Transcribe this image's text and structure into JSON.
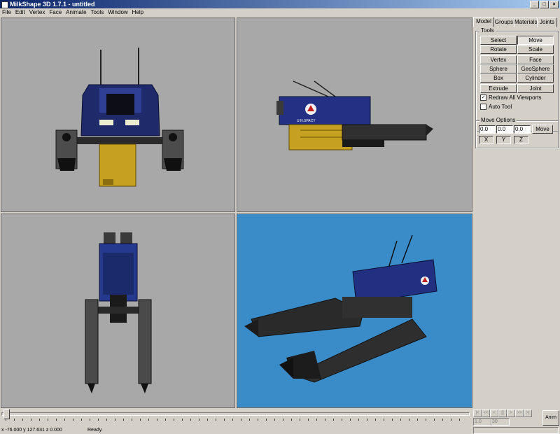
{
  "window": {
    "title": "MilkShape 3D 1.7.1 - untitled",
    "buttons": [
      "_",
      "□",
      "×"
    ]
  },
  "menu": [
    "File",
    "Edit",
    "Vertex",
    "Face",
    "Animate",
    "Tools",
    "Window",
    "Help"
  ],
  "viewports": [
    {
      "name": "front",
      "background": "#a8a8a8"
    },
    {
      "name": "side",
      "background": "#a8a8a8"
    },
    {
      "name": "top",
      "background": "#a8a8a8"
    },
    {
      "name": "3d",
      "background": "#3a8cc8"
    }
  ],
  "model_label": "U.N.SPACY",
  "panel": {
    "tabs": [
      "Model",
      "Groups",
      "Materials",
      "Joints"
    ],
    "tools_label": "Tools",
    "tools": [
      "Select",
      "Move",
      "Rotate",
      "Scale",
      "Vertex",
      "Face",
      "Sphere",
      "GeoSphere",
      "Box",
      "Cylinder",
      "Extrude",
      "Joint"
    ],
    "active_tool": "Move",
    "redraw_label": "Redraw All Viewports",
    "redraw_checked": true,
    "autotool_label": "Auto Tool",
    "autotool_checked": false,
    "move_options_label": "Move Options",
    "move_values": [
      "0.0",
      "0.0",
      "0.0"
    ],
    "move_button": "Move",
    "axes": [
      "X",
      "Y",
      "Z"
    ]
  },
  "timeline": {
    "nav": [
      "|<",
      "<<",
      "<",
      "[]",
      ">",
      ">>",
      ">|"
    ],
    "frame": "1.0",
    "frame_count": "30",
    "anim_button": "Anim"
  },
  "status": {
    "coords": "x -76.000 y 127.631 z 0.000",
    "state": "Ready."
  }
}
